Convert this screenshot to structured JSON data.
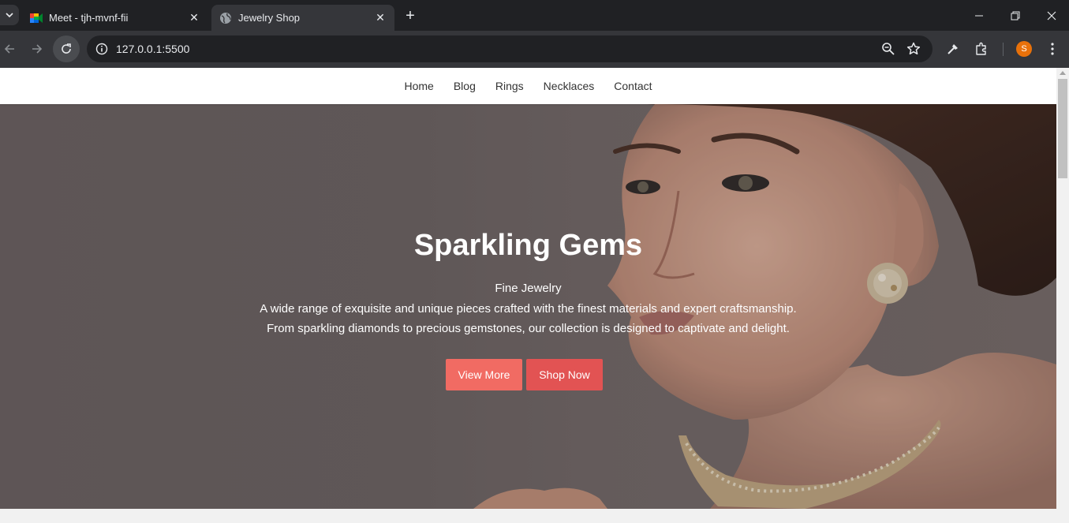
{
  "browser": {
    "tabs": [
      {
        "title": "Meet - tjh-mvnf-fii",
        "active": false,
        "icon": "google-meet-icon"
      },
      {
        "title": "Jewelry Shop",
        "active": true,
        "icon": "globe-icon"
      }
    ],
    "url": "127.0.0.1:5500",
    "profile_initial": "S",
    "colors": {
      "frame": "#202124",
      "toolbar": "#35363a",
      "profile": "#e8710a"
    }
  },
  "nav": {
    "items": [
      "Home",
      "Blog",
      "Rings",
      "Necklaces",
      "Contact"
    ]
  },
  "hero": {
    "title": "Sparkling Gems",
    "subtitle": "Fine Jewelry",
    "description_line1": "A wide range of exquisite and unique pieces crafted with the finest materials and expert craftsmanship.",
    "description_line2": "From sparkling diamonds to precious gemstones, our collection is designed to captivate and delight.",
    "primary_button": "View More",
    "secondary_button": "Shop Now",
    "colors": {
      "primary_button": "#f16b63",
      "secondary_button": "#e25353"
    }
  }
}
